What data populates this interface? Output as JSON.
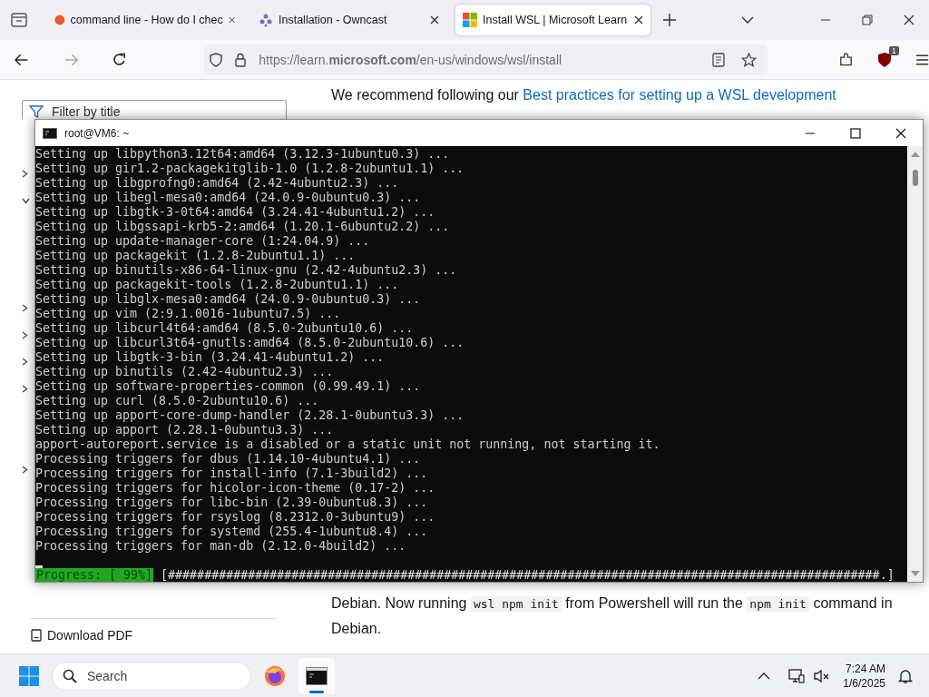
{
  "browser": {
    "tabs": [
      {
        "title": "command line - How do I chec",
        "selected": false,
        "kind": "bubble"
      },
      {
        "title": "Installation - Owncast",
        "selected": false,
        "kind": "flower"
      },
      {
        "title": "Install WSL | Microsoft Learn",
        "selected": true,
        "kind": "squares"
      }
    ],
    "url": "https://learn.**microsoft.com**/en-us/windows/wsl/install",
    "extension_badge": "1"
  },
  "page": {
    "filter": {
      "placeholder": "Filter by title"
    },
    "toc": [
      {
        "kind": "branch",
        "expanded": false
      },
      {
        "kind": "branch",
        "expanded": true
      },
      {
        "kind": "leaf"
      },
      {
        "kind": "leaf"
      },
      {
        "kind": "leaf"
      },
      {
        "kind": "branch",
        "expanded": false
      },
      {
        "kind": "branch",
        "expanded": false
      },
      {
        "kind": "branch",
        "expanded": false
      },
      {
        "kind": "branch",
        "expanded": false
      },
      {
        "kind": "leaf"
      },
      {
        "kind": "leaf"
      },
      {
        "kind": "branch",
        "expanded": false
      }
    ],
    "download": "Download PDF",
    "intro": {
      "text": "We recommend following our ",
      "link": "Best practices for setting up a WSL development"
    },
    "paragraph": [
      [
        {
          "kind": "text",
          "text": "Debian. Now running "
        },
        {
          "kind": "code",
          "text": "wsl npm init"
        },
        {
          "kind": "text",
          "text": " from Powershell will run the "
        },
        {
          "kind": "code",
          "text": "npm init"
        },
        {
          "kind": "text",
          "text": " command in"
        }
      ],
      [
        {
          "kind": "text",
          "text": "Debian."
        }
      ]
    ]
  },
  "terminal": {
    "title": "root@VM6: ~",
    "lines": [
      "Setting up libpython3.12t64:amd64 (3.12.3-1ubuntu0.3) ...",
      "Setting up gir1.2-packagekitglib-1.0 (1.2.8-2ubuntu1.1) ...",
      "Setting up libgprofng0:amd64 (2.42-4ubuntu2.3) ...",
      "Setting up libegl-mesa0:amd64 (24.0.9-0ubuntu0.3) ...",
      "Setting up libgtk-3-0t64:amd64 (3.24.41-4ubuntu1.2) ...",
      "Setting up libgssapi-krb5-2:amd64 (1.20.1-6ubuntu2.2) ...",
      "Setting up update-manager-core (1:24.04.9) ...",
      "Setting up packagekit (1.2.8-2ubuntu1.1) ...",
      "Setting up binutils-x86-64-linux-gnu (2.42-4ubuntu2.3) ...",
      "Setting up packagekit-tools (1.2.8-2ubuntu1.1) ...",
      "Setting up libglx-mesa0:amd64 (24.0.9-0ubuntu0.3) ...",
      "Setting up vim (2:9.1.0016-1ubuntu7.5) ...",
      "Setting up libcurl4t64:amd64 (8.5.0-2ubuntu10.6) ...",
      "Setting up libcurl3t64-gnutls:amd64 (8.5.0-2ubuntu10.6) ...",
      "Setting up libgtk-3-bin (3.24.41-4ubuntu1.2) ...",
      "Setting up binutils (2.42-4ubuntu2.3) ...",
      "Setting up software-properties-common (0.99.49.1) ...",
      "Setting up curl (8.5.0-2ubuntu10.6) ...",
      "Setting up apport-core-dump-handler (2.28.1-0ubuntu3.3) ...",
      "Setting up apport (2.28.1-0ubuntu3.3) ...",
      "apport-autoreport.service is a disabled or a static unit not running, not starting it.",
      "Processing triggers for dbus (1.14.10-4ubuntu4.1) ...",
      "Processing triggers for install-info (7.1-3build2) ...",
      "Processing triggers for hicolor-icon-theme (0.17-2) ...",
      "Processing triggers for libc-bin (2.39-0ubuntu8.3) ...",
      "Processing triggers for rsyslog (8.2312.0-3ubuntu9) ...",
      "Processing triggers for systemd (255.4-1ubuntu8.4) ...",
      "Processing triggers for man-db (2.12.0-4build2) ..."
    ],
    "progress_label": "Progress: [ 99%]",
    "progress_bar": "[##################################################################################################.]"
  },
  "taskbar": {
    "search": {
      "placeholder": "Search"
    },
    "apps": [
      {
        "kind": "browser",
        "selected": false
      },
      {
        "kind": "terminal",
        "selected": true
      }
    ],
    "time": "7:24 AM",
    "date": "1/6/2025"
  }
}
